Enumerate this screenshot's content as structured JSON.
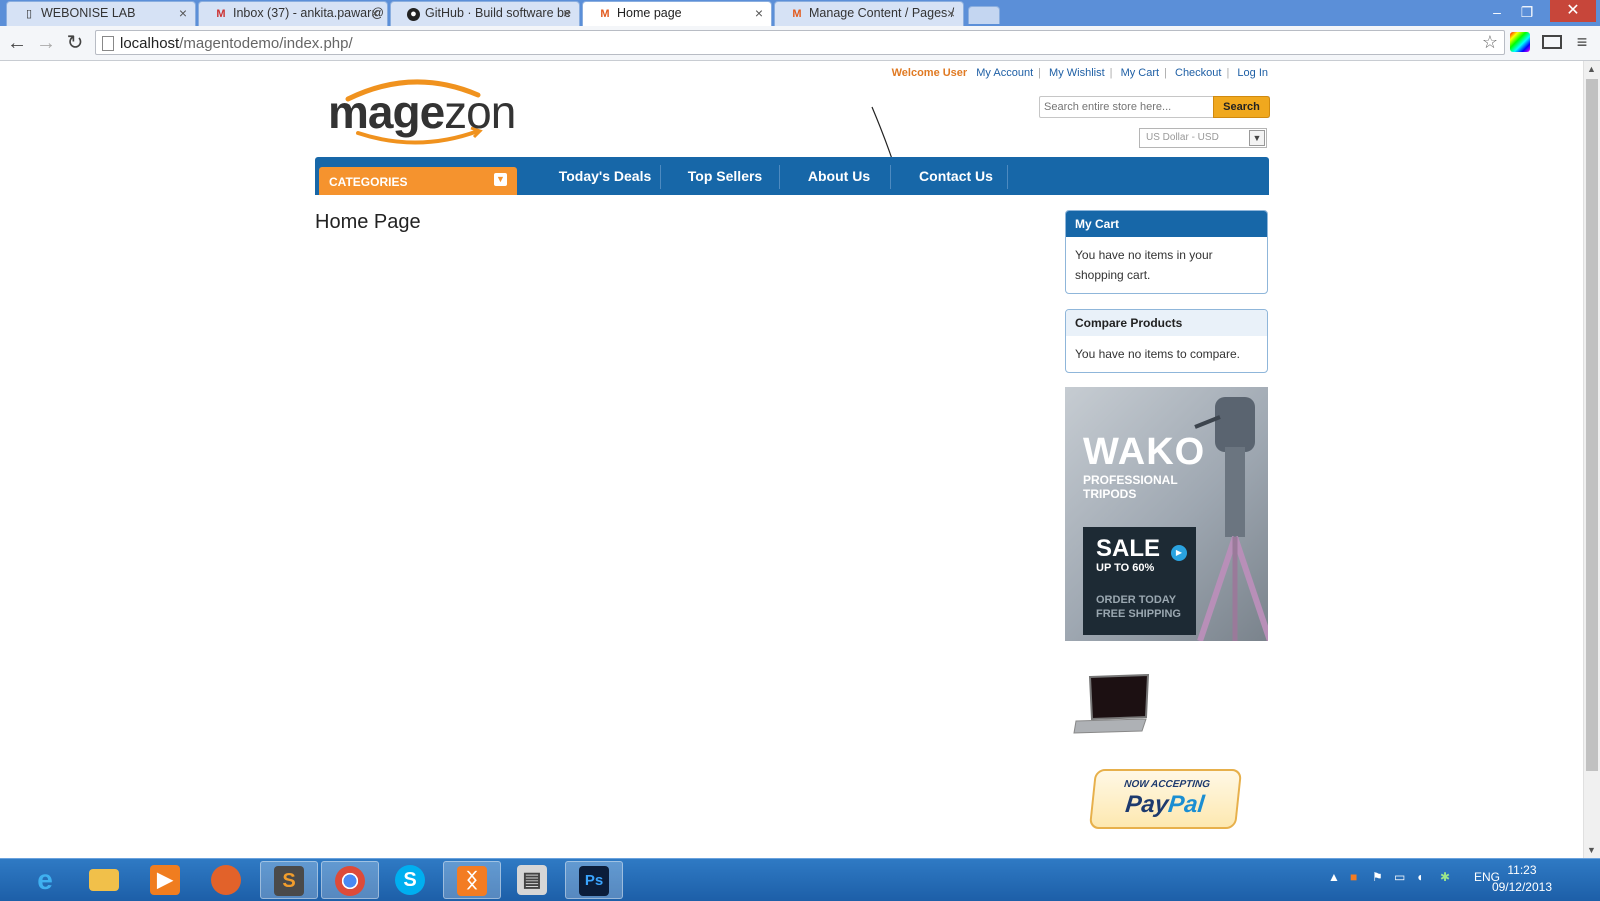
{
  "browser": {
    "tabs": [
      {
        "title": "WEBONISE LAB",
        "icon": "page-icon"
      },
      {
        "title": "Inbox (37) - ankita.pawar@",
        "icon": "gmail-icon"
      },
      {
        "title": "GitHub · Build software be",
        "icon": "github-icon"
      },
      {
        "title": "Home page",
        "icon": "magento-icon",
        "active": true
      },
      {
        "title": "Manage Content / Pages /",
        "icon": "magento-icon"
      }
    ],
    "url_host": "localhost",
    "url_path": "/magentodemo/index.php/"
  },
  "header": {
    "welcome": "Welcome User",
    "links": [
      "My Account",
      "My Wishlist",
      "My Cart",
      "Checkout",
      "Log In"
    ],
    "logo_main": "mage",
    "logo_lite": "zon",
    "search_placeholder": "Search entire store here...",
    "search_button": "Search",
    "currency": "US Dollar - USD"
  },
  "nav": {
    "categories": "CATEGORIES",
    "items": [
      "Today's Deals",
      "Top Sellers",
      "About Us",
      "Contact Us"
    ]
  },
  "main": {
    "title": "Home Page"
  },
  "sidebar": {
    "cart_title": "My Cart",
    "cart_text": "You have no items in your shopping cart.",
    "compare_title": "Compare Products",
    "compare_text": "You have no items to compare.",
    "banner": {
      "brand": "WAKO",
      "sub1": "PROFESSIONAL",
      "sub2": "TRIPODS",
      "sale": "SALE",
      "upto": "UP TO 60%",
      "order1": "ORDER TODAY",
      "order2": "FREE SHIPPING"
    },
    "paypal_now": "NOW ACCEPTING",
    "paypal_pay": "Pay",
    "paypal_pal": "Pal"
  },
  "taskbar": {
    "lang": "ENG",
    "time": "11:23",
    "date": "09/12/2013"
  },
  "colors": {
    "nav_blue": "#1767a8",
    "categories_orange": "#f5932e",
    "search_button": "#f0a81e",
    "welcome_orange": "#e07a23"
  }
}
